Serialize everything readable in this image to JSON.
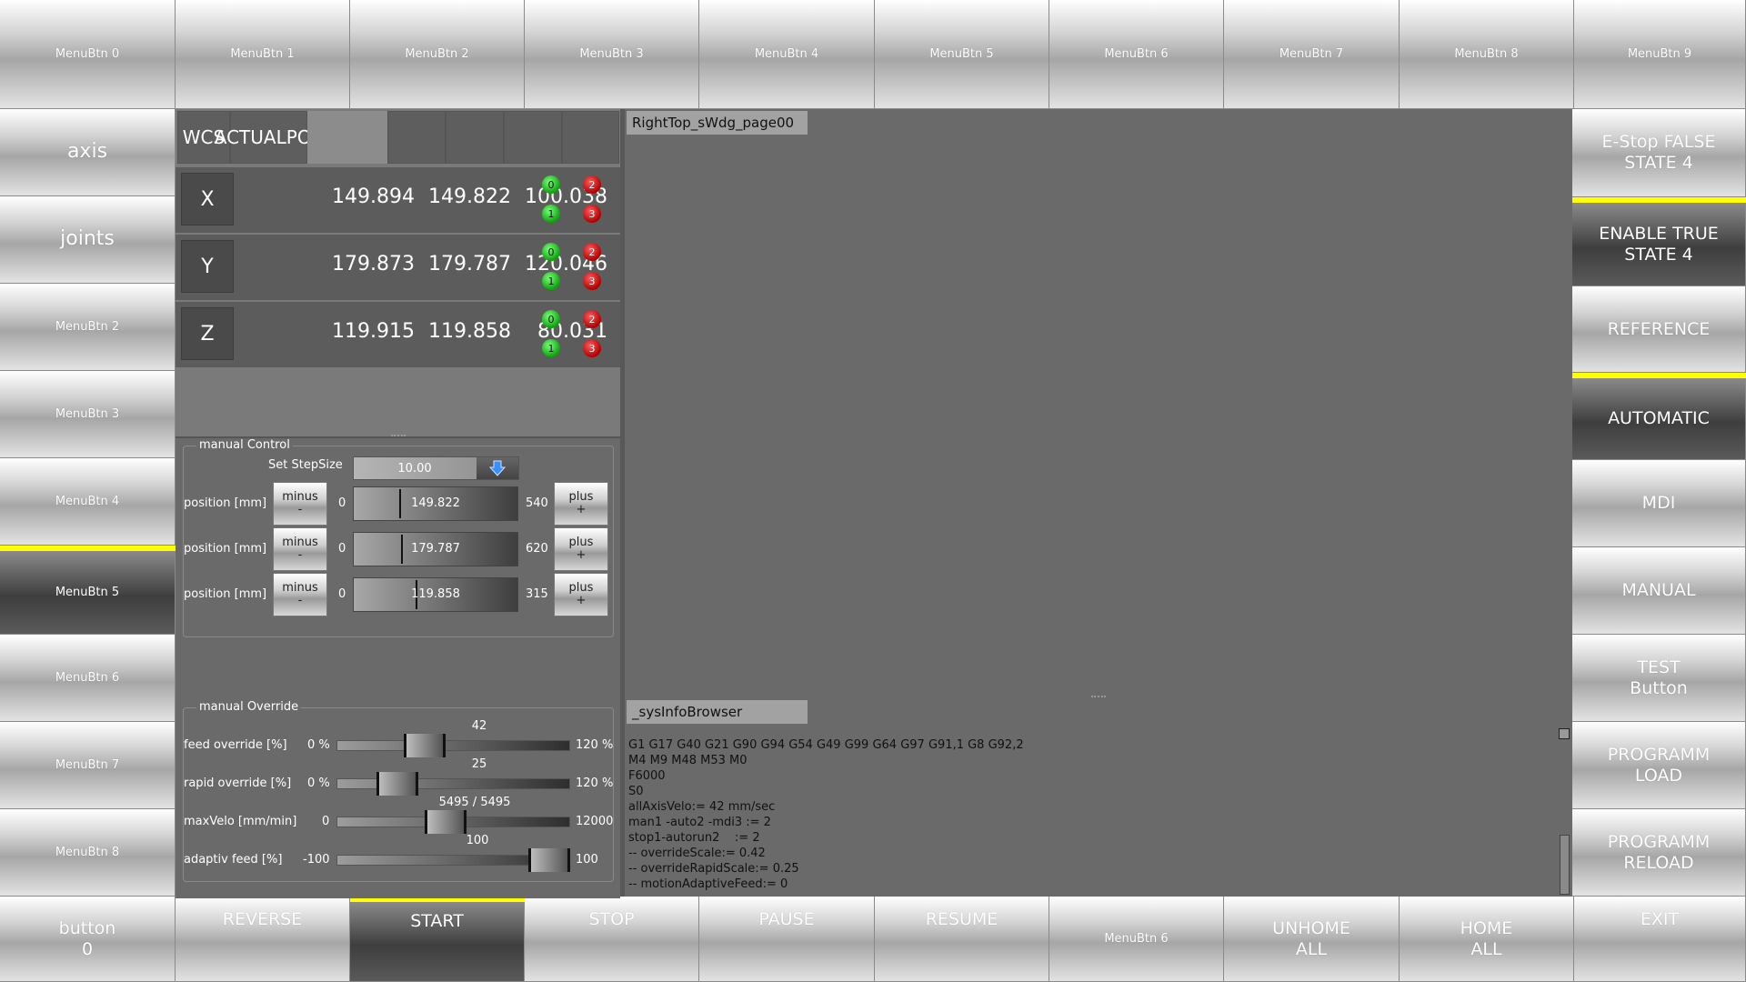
{
  "top_menu": [
    "MenuBtn 0",
    "MenuBtn 1",
    "MenuBtn 2",
    "MenuBtn 3",
    "MenuBtn 4",
    "MenuBtn 5",
    "MenuBtn 6",
    "MenuBtn 7",
    "MenuBtn 8",
    "MenuBtn 9"
  ],
  "left_menu": [
    "axis",
    "joints",
    "MenuBtn 2",
    "MenuBtn 3",
    "MenuBtn 4",
    "MenuBtn 5",
    "MenuBtn 6",
    "MenuBtn 7",
    "MenuBtn 8"
  ],
  "right_menu": [
    {
      "line1": "E-Stop FALSE",
      "line2": "STATE 4"
    },
    {
      "line1": "ENABLE TRUE",
      "line2": "STATE 4"
    },
    {
      "line1": "REFERENCE",
      "line2": ""
    },
    {
      "line1": "AUTOMATIC",
      "line2": ""
    },
    {
      "line1": "MDI",
      "line2": ""
    },
    {
      "line1": "MANUAL",
      "line2": ""
    },
    {
      "line1": "TEST",
      "line2": "Button"
    },
    {
      "line1": "PROGRAMM",
      "line2": "LOAD"
    },
    {
      "line1": "PROGRAMM",
      "line2": "RELOAD"
    }
  ],
  "bottom_menu": [
    {
      "line1": "button",
      "line2": "0"
    },
    {
      "line1": "REVERSE",
      "line2": ""
    },
    {
      "line1": "START",
      "line2": ""
    },
    {
      "line1": "STOP",
      "line2": ""
    },
    {
      "line1": "PAUSE",
      "line2": ""
    },
    {
      "line1": "RESUME",
      "line2": ""
    },
    {
      "line1": "MenuBtn 6",
      "line2": ""
    },
    {
      "line1": "UNHOME",
      "line2": "ALL"
    },
    {
      "line1": "HOME",
      "line2": "ALL"
    },
    {
      "line1": "EXIT",
      "line2": ""
    }
  ],
  "dro": {
    "header": {
      "wcs": "WCS",
      "actual_line1": "ACTUAL",
      "actual_line2": "POS"
    },
    "axes": [
      {
        "name": "X",
        "v1": "149.894",
        "v2": "149.822",
        "v3": "100.038"
      },
      {
        "name": "Y",
        "v1": "179.873",
        "v2": "179.787",
        "v3": "120.046"
      },
      {
        "name": "Z",
        "v1": "119.915",
        "v2": "119.858",
        "v3": "80.031"
      }
    ],
    "leds": [
      "0",
      "1",
      "2",
      "3"
    ]
  },
  "manual_control": {
    "title": "manual Control",
    "stepsize_label": "Set StepSize",
    "stepsize_value": "10.00",
    "rows": [
      {
        "label": "position [mm]",
        "minus_top": "minus",
        "minus_bottom": "-",
        "min": "0",
        "value": "149.822",
        "max": "540",
        "plus_top": "plus",
        "plus_bottom": "+",
        "fraction": 0.277
      },
      {
        "label": "position [mm]",
        "minus_top": "minus",
        "minus_bottom": "-",
        "min": "0",
        "value": "179.787",
        "max": "620",
        "plus_top": "plus",
        "plus_bottom": "+",
        "fraction": 0.29
      },
      {
        "label": "position [mm]",
        "minus_top": "minus",
        "minus_bottom": "-",
        "min": "0",
        "value": "119.858",
        "max": "315",
        "plus_top": "plus",
        "plus_bottom": "+",
        "fraction": 0.38
      }
    ]
  },
  "manual_override": {
    "title": "manual Override",
    "rows": [
      {
        "label": "feed override [%]",
        "min": "0 %",
        "max": "120 %",
        "value": "42",
        "fraction": 0.35
      },
      {
        "label": "rapid override [%]",
        "min": "0 %",
        "max": "120 %",
        "value": "25",
        "fraction": 0.21
      },
      {
        "label": "maxVelo [mm/min]",
        "min": "0",
        "max": "12000",
        "value": "5495 / 5495",
        "fraction": 0.46
      },
      {
        "label": "adaptiv feed [%]",
        "min": "-100",
        "max": "100",
        "value": "100",
        "fraction": 1.0
      }
    ]
  },
  "right_top": {
    "title": "RightTop_sWdg_page00"
  },
  "sys_info": {
    "title": "_sysInfoBrowser",
    "lines": [
      "G1 G17 G40 G21 G90 G94 G54 G49 G99 G64 G97 G91,1 G8 G92,2",
      "M4 M9 M48 M53 M0",
      "F6000",
      "S0",
      "allAxisVelo:= 42 mm/sec",
      "man1 -auto2 -mdi3 := 2",
      "stop1-autorun2    := 2",
      "-- overrideScale:= 0.42",
      "-- overrideRapidScale:= 0.25",
      "-- motionAdaptiveFeed:= 0"
    ]
  },
  "colors": {
    "accent": "#ffff00",
    "led_green": "#0aa30a",
    "led_red": "#b00000"
  }
}
